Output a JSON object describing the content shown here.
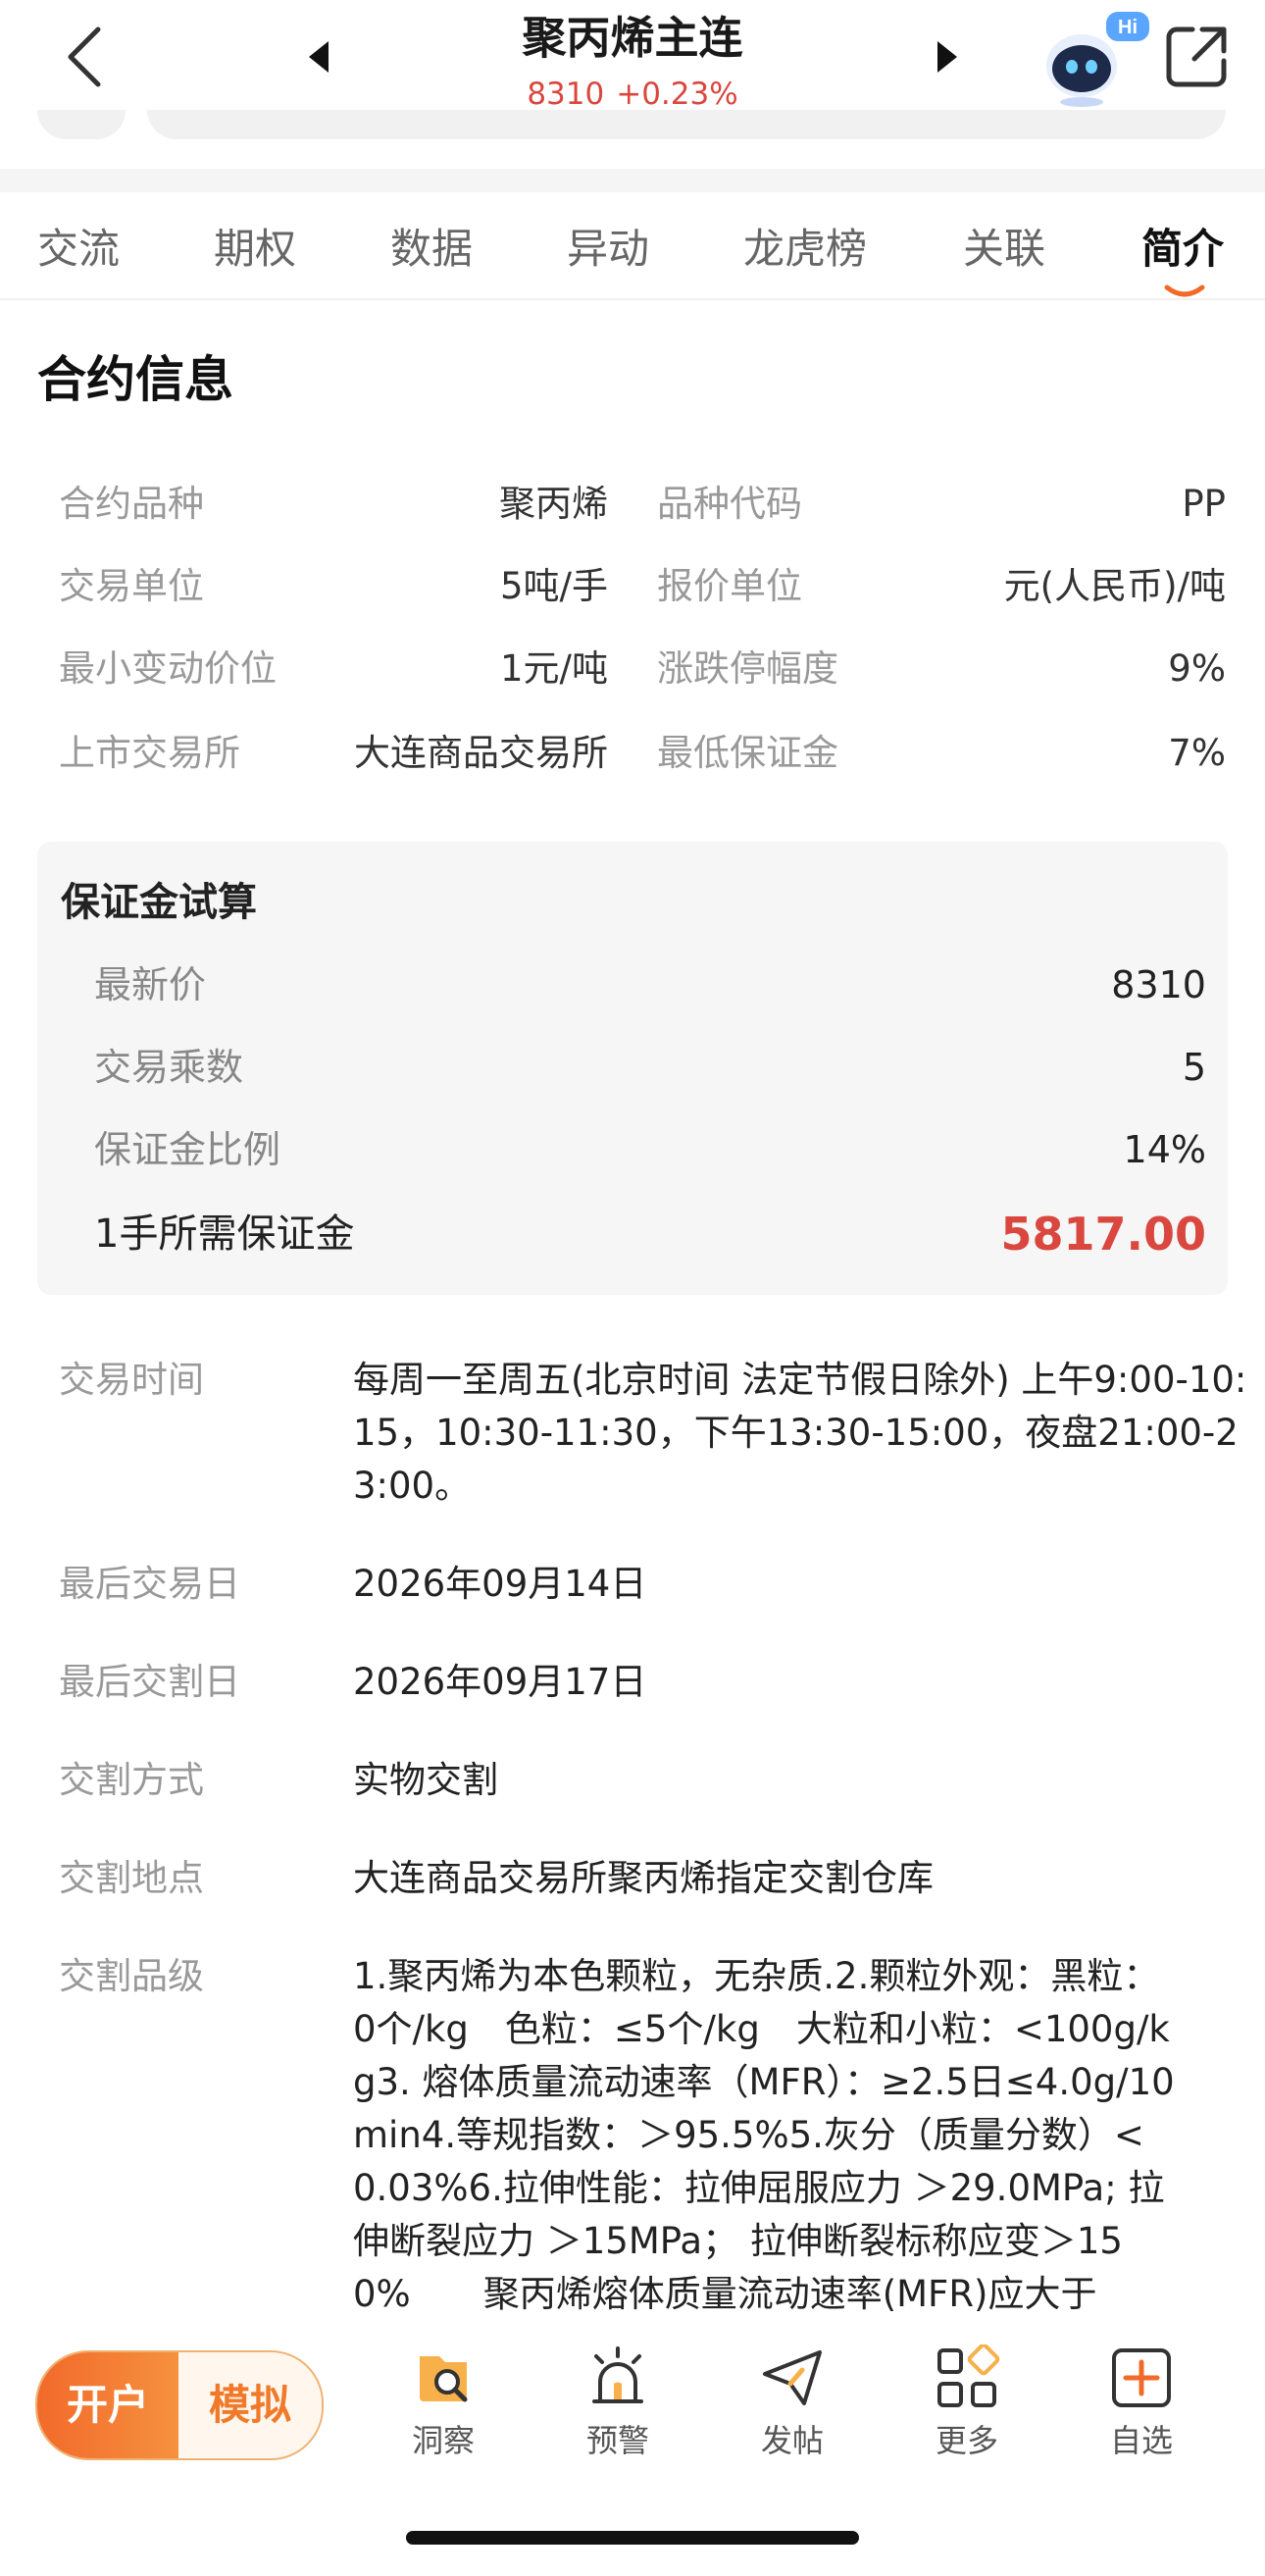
{
  "header": {
    "title": "聚丙烯主连",
    "price": "8310",
    "change": "+0.23%",
    "badge": "Hi"
  },
  "tabs": [
    {
      "label": "交流"
    },
    {
      "label": "期权"
    },
    {
      "label": "数据"
    },
    {
      "label": "异动"
    },
    {
      "label": "龙虎榜"
    },
    {
      "label": "关联"
    },
    {
      "label": "简介",
      "active": true
    }
  ],
  "contract": {
    "title": "合约信息",
    "rows": [
      {
        "l1": "合约品种",
        "v1": "聚丙烯",
        "l2": "品种代码",
        "v2": "PP"
      },
      {
        "l1": "交易单位",
        "v1": "5吨/手",
        "l2": "报价单位",
        "v2": "元(人民币)/吨"
      },
      {
        "l1": "最小变动价位",
        "v1": "1元/吨",
        "l2": "涨跌停幅度",
        "v2": "9%"
      },
      {
        "l1": "上市交易所",
        "v1": "大连商品交易所",
        "l2": "最低保证金",
        "v2": "7%"
      }
    ]
  },
  "margin": {
    "title": "保证金试算",
    "rows": [
      {
        "label": "最新价",
        "value": "8310"
      },
      {
        "label": "交易乘数",
        "value": "5"
      },
      {
        "label": "保证金比例",
        "value": "14%"
      }
    ],
    "total_label": "1手所需保证金",
    "total_value": "5817.00"
  },
  "details": [
    {
      "label": "交易时间",
      "value": "每周一至周五(北京时间 法定节假日除外) 上午9:00-10:15，10:30-11:30，下午13:30-15:00，夜盘21:00-23:00。"
    },
    {
      "label": "最后交易日",
      "value": "2026年09月14日"
    },
    {
      "label": "最后交割日",
      "value": "2026年09月17日"
    },
    {
      "label": "交割方式",
      "value": "实物交割"
    },
    {
      "label": "交割地点",
      "value": "大连商品交易所聚丙烯指定交割仓库"
    },
    {
      "label": "交割品级",
      "value": "1.聚丙烯为本色颗粒，无杂质.2.颗粒外观：黑粒：0个/kg　色粒：≤5个/kg　大粒和小粒：<100g/kg3. 熔体质量流动速率（MFR）：≥2.5日≤4.0g/10min4.等规指数：＞95.5%5.灰分（质量分数）<0.03%6.拉伸性能：拉伸屈服应力 ＞29.0MPa; 拉伸断裂应力 ＞15MPa； 拉伸断裂标称应变＞150%　　聚丙烯熔体质量流动速率(MFR)应大于"
    }
  ],
  "bottom": {
    "open_label": "开户",
    "sim_label": "模拟",
    "nav": [
      {
        "label": "洞察",
        "icon": "insight-icon"
      },
      {
        "label": "预警",
        "icon": "alarm-icon"
      },
      {
        "label": "发帖",
        "icon": "send-icon"
      },
      {
        "label": "更多",
        "icon": "grid-icon"
      },
      {
        "label": "自选",
        "icon": "add-icon"
      }
    ]
  },
  "colors": {
    "accent": "#f26a2a",
    "rise": "#d9473f"
  }
}
